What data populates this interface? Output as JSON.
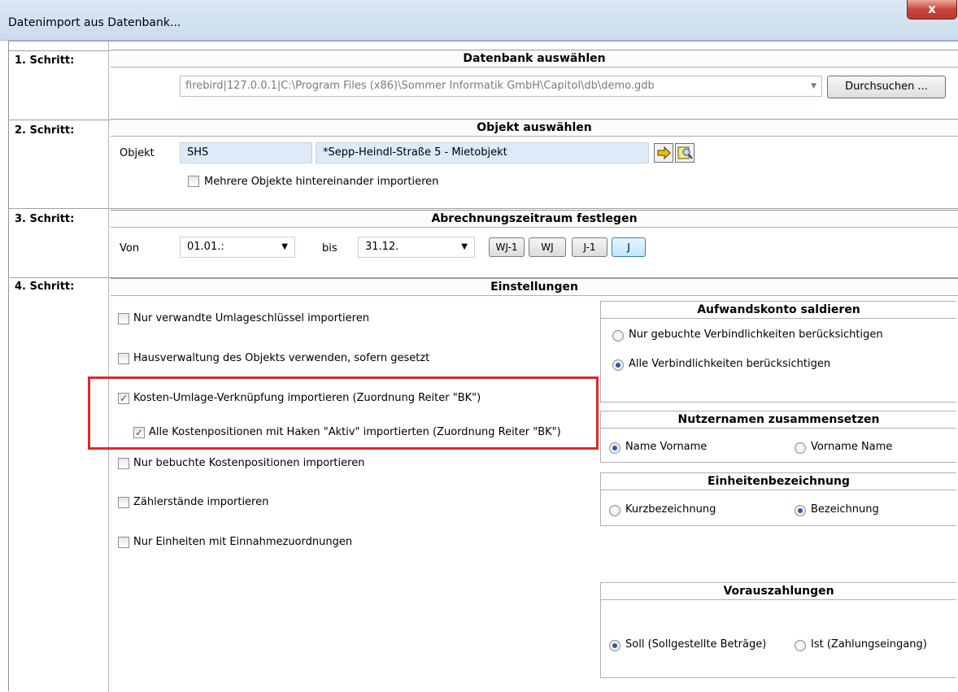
{
  "window": {
    "title": "Datenimport aus Datenbank...",
    "close": "x"
  },
  "step1": {
    "label": "1. Schritt:",
    "header": "Datenbank auswählen",
    "db_path": "firebird|127.0.0.1|C:\\Program Files (x86)\\Sommer Informatik GmbH\\Capitol\\db\\demo.gdb",
    "browse_button": "Durchsuchen ..."
  },
  "step2": {
    "label": "2. Schritt:",
    "header": "Objekt auswählen",
    "objekt_label": "Objekt",
    "objekt_code": "SHS",
    "objekt_name": "*Sepp-Heindl-Straße 5 - Mietobjekt",
    "multi_checkbox": "Mehrere Objekte hintereinander importieren"
  },
  "step3": {
    "label": "3. Schritt:",
    "header": "Abrechnungszeitraum festlegen",
    "von_label": "Von",
    "von_value": "01.01.:",
    "bis_label": "bis",
    "bis_value": "31.12.",
    "buttons": [
      "WJ-1",
      "WJ",
      "J-1",
      "J"
    ]
  },
  "step4": {
    "label": "4. Schritt:",
    "header": "Einstellungen",
    "checkboxes": [
      {
        "label": "Nur verwandte Umlageschlüssel importieren",
        "checked": false
      },
      {
        "label": "Hausverwaltung des Objekts verwenden, sofern gesetzt",
        "checked": false
      },
      {
        "label": "Kosten-Umlage-Verknüpfung importieren (Zuordnung Reiter \"BK\")",
        "checked": true
      },
      {
        "label": "Alle Kostenpositionen mit Haken \"Aktiv\" importierten (Zuordnung Reiter \"BK\")",
        "checked": true
      },
      {
        "label": "Nur bebuchte Kostenpositionen importieren",
        "checked": false
      },
      {
        "label": "Zählerstände importieren",
        "checked": false
      },
      {
        "label": "Nur Einheiten mit Einnahmezuordnungen",
        "checked": false
      }
    ],
    "aufwand": {
      "header": "Aufwandskonto saldieren",
      "opt1": "Nur gebuchte Verbindlichkeiten berücksichtigen",
      "opt2": "Alle Verbindlichkeiten berücksichtigen"
    },
    "nutzer": {
      "header": "Nutzernamen zusammensetzen",
      "opt1": "Name Vorname",
      "opt2": "Vorname Name"
    },
    "einheiten": {
      "header": "Einheitenbezeichnung",
      "opt1": "Kurzbezeichnung",
      "opt2": "Bezeichnung"
    },
    "voraus": {
      "header": "Vorauszahlungen",
      "opt1": "Soll (Sollgestellte Beträge)",
      "opt2": "Ist (Zahlungseingang)"
    }
  },
  "colors": {
    "highlight_box": "#e0262d",
    "field_bg": "#dcebf7",
    "radio_dot": "#2a5aa8"
  }
}
